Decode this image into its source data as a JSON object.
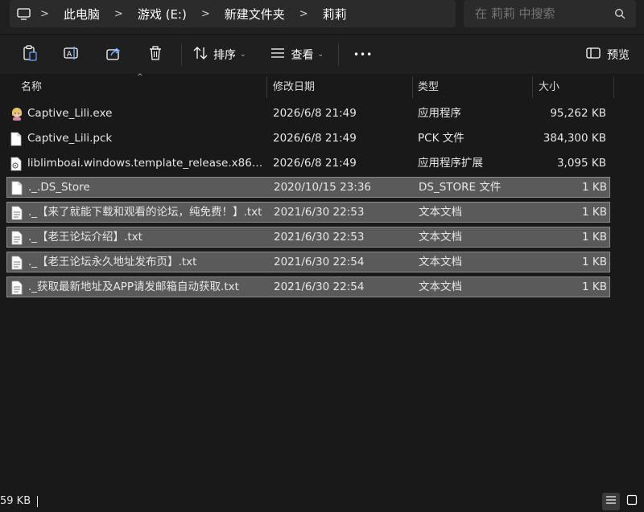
{
  "breadcrumb": {
    "items": [
      "此电脑",
      "游戏 (E:)",
      "新建文件夹",
      "莉莉"
    ],
    "separator": ">"
  },
  "search": {
    "placeholder": "在 莉莉 中搜索"
  },
  "toolbar": {
    "sort_label": "排序",
    "view_label": "查看",
    "more_label": "•••",
    "preview_label": "预览"
  },
  "columns": {
    "name": "名称",
    "date": "修改日期",
    "type": "类型",
    "size": "大小"
  },
  "files": [
    {
      "name": "Captive_Lili.exe",
      "date": "2026/6/8 21:49",
      "type": "应用程序",
      "size": "95,262 KB",
      "icon": "app-icon",
      "selected": false
    },
    {
      "name": "Captive_Lili.pck",
      "date": "2026/6/8 21:49",
      "type": "PCK 文件",
      "size": "384,300 KB",
      "icon": "file-icon",
      "selected": false
    },
    {
      "name": "liblimboai.windows.template_release.x86_64...",
      "date": "2026/6/8 21:49",
      "type": "应用程序扩展",
      "size": "3,095 KB",
      "icon": "dll-icon",
      "selected": false
    },
    {
      "name": "._.DS_Store",
      "date": "2020/10/15 23:36",
      "type": "DS_STORE 文件",
      "size": "1 KB",
      "icon": "file-icon",
      "selected": true
    },
    {
      "name": "._【来了就能下载和观看的论坛，纯免费！】.txt",
      "date": "2021/6/30 22:53",
      "type": "文本文档",
      "size": "1 KB",
      "icon": "text-file-icon",
      "selected": true
    },
    {
      "name": "._【老王论坛介绍】.txt",
      "date": "2021/6/30 22:53",
      "type": "文本文档",
      "size": "1 KB",
      "icon": "text-file-icon",
      "selected": true
    },
    {
      "name": "._【老王论坛永久地址发布页】.txt",
      "date": "2021/6/30 22:54",
      "type": "文本文档",
      "size": "1 KB",
      "icon": "text-file-icon",
      "selected": true
    },
    {
      "name": "._获取最新地址及APP请发邮箱自动获取.txt",
      "date": "2021/6/30 22:54",
      "type": "文本文档",
      "size": "1 KB",
      "icon": "text-file-icon",
      "selected": true
    }
  ],
  "status": {
    "selection_size": "59 KB"
  }
}
